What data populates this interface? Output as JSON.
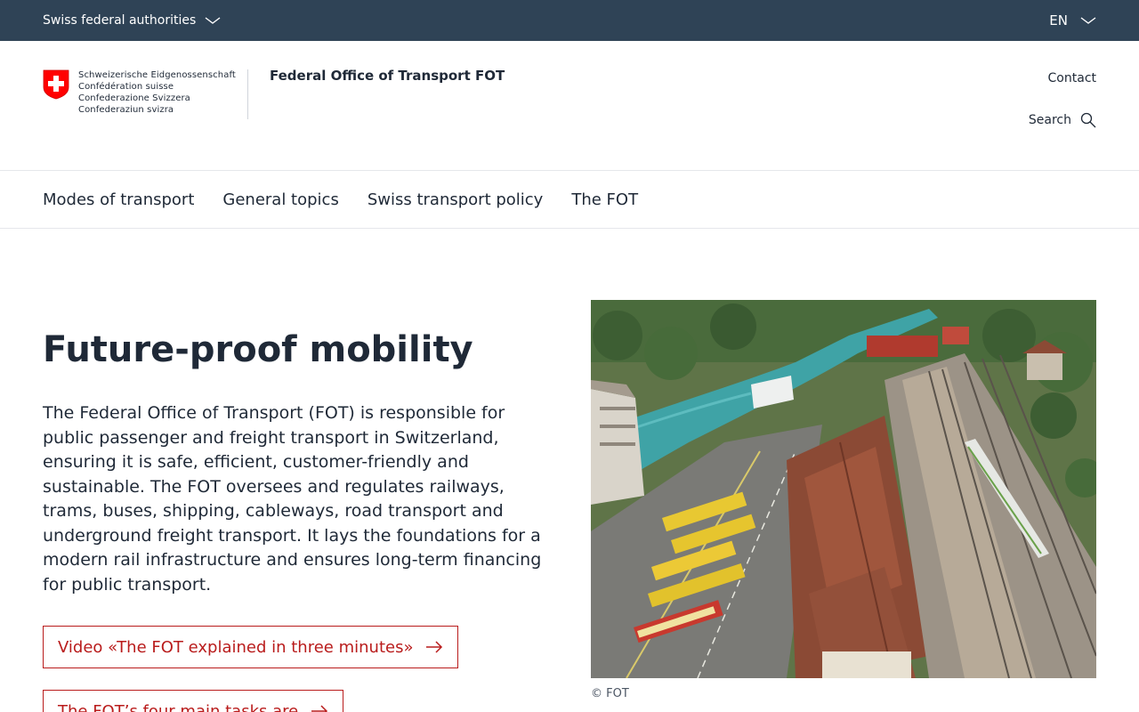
{
  "topbar": {
    "authorities_label": "Swiss federal authorities",
    "language": "EN"
  },
  "header": {
    "confederation_names": [
      "Schweizerische Eidgenossenschaft",
      "Confédération suisse",
      "Confederazione Svizzera",
      "Confederaziun svizra"
    ],
    "office_name": "Federal Office of Transport FOT",
    "contact_label": "Contact",
    "search_label": "Search"
  },
  "nav": {
    "items": [
      {
        "label": "Modes of transport"
      },
      {
        "label": "General topics"
      },
      {
        "label": "Swiss transport policy"
      },
      {
        "label": "The FOT"
      }
    ]
  },
  "hero": {
    "title": "Future-proof mobility",
    "text": "The Federal Office of Transport (FOT) is responsible for public passenger and freight transport in Switzerland, ensuring it is safe, efficient, customer-friendly and sustainable. The FOT oversees and regulates railways, trams, buses, shipping, cableways, road transport and underground freight transport. It lays the foundations for a modern rail infrastructure and ensures long-term financing for public transport.",
    "cta_video": "Video «The FOT explained in three minutes»",
    "cta_tasks": "The FOT’s four main tasks are",
    "image_caption": "© FOT"
  },
  "colors": {
    "topbar_bg": "#2f4356",
    "accent_red": "#b91c1c",
    "swiss_red": "#ff0000"
  }
}
